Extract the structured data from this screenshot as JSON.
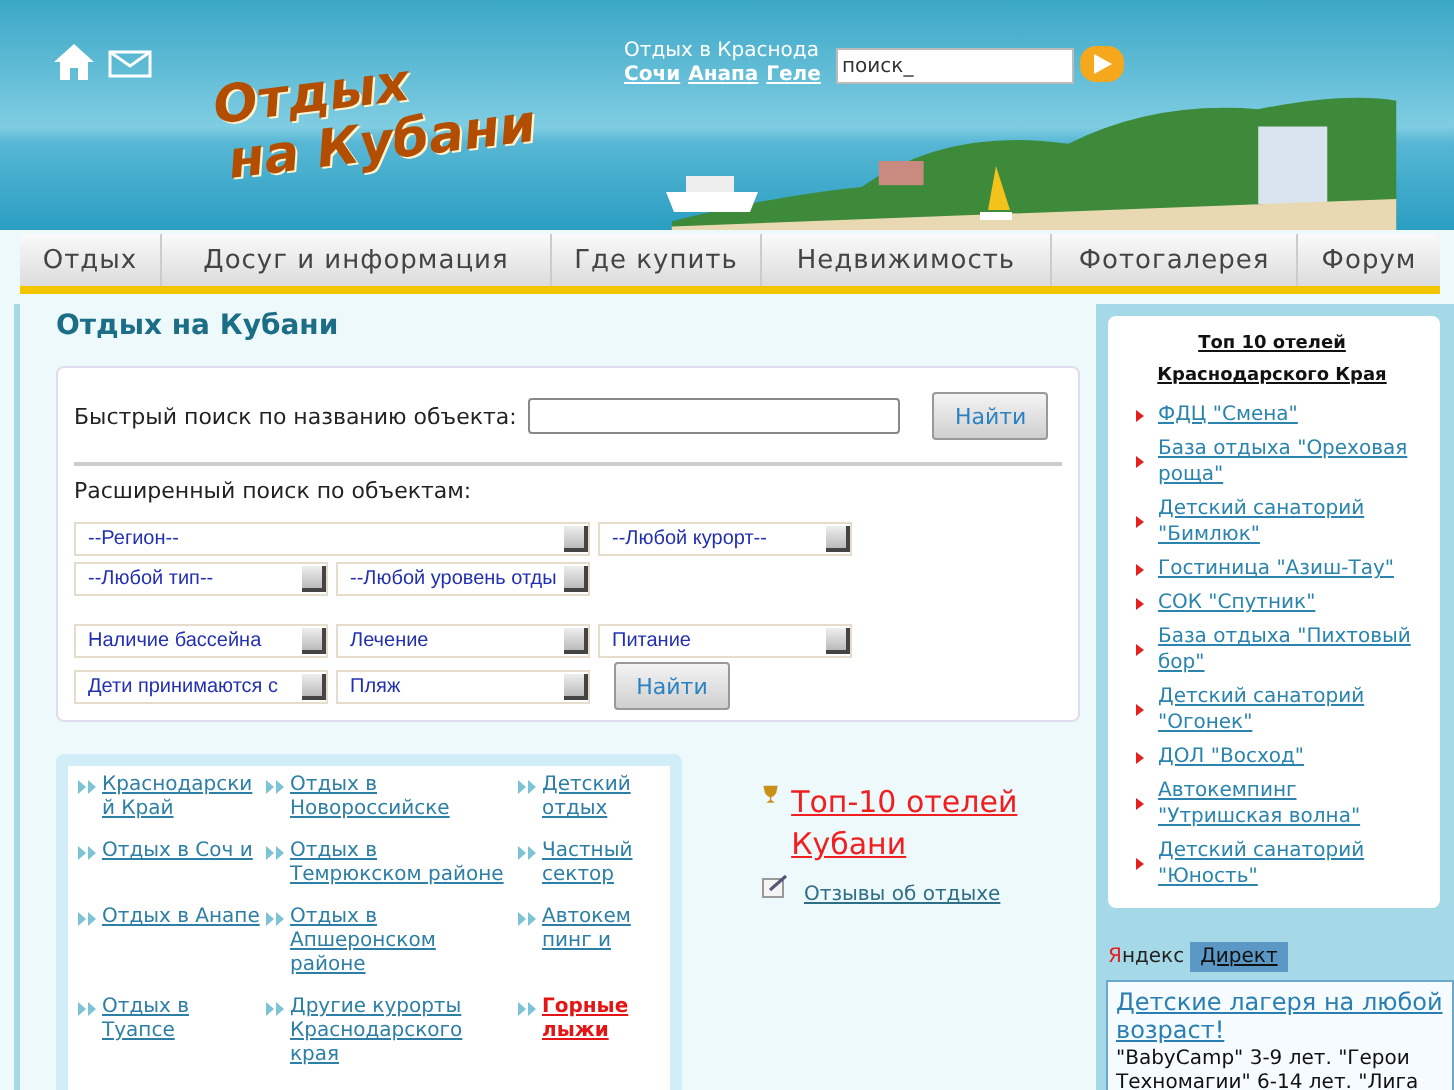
{
  "header": {
    "logo_line_1": "Отдых",
    "logo_line_2": "на Кубани",
    "tagline": "Отдых в Краснода",
    "city_links": [
      "Сочи",
      "Анапа",
      "Геле"
    ],
    "search": {
      "value": "поиск_"
    }
  },
  "nav": [
    {
      "label": "Отдых"
    },
    {
      "label": "Досуг и информация"
    },
    {
      "label": "Где купить"
    },
    {
      "label": "Недвижимость"
    },
    {
      "label": "Фотогалерея"
    },
    {
      "label": "Форум"
    }
  ],
  "page_title": "Отдых на Кубани",
  "quick_search": {
    "label": "Быстрый поиск по названию объекта:",
    "button": "Найти"
  },
  "advanced_search": {
    "label": "Расширенный поиск по объектам:",
    "dropdowns": [
      "--Регион--",
      "--Любой курорт--",
      "--Любой тип--",
      "--Любой уровень отды",
      "Наличие бассейна",
      "Лечение",
      "Питание",
      "Дети принимаются с",
      "Пляж"
    ],
    "button": "Найти"
  },
  "region_links": [
    {
      "label": "Краснодарский Край",
      "kind": "normal"
    },
    {
      "label": "Отдых в Новороссийске",
      "kind": "normal"
    },
    {
      "label": "Детский отдых",
      "kind": "normal"
    },
    {
      "label": "Отдых в Соч и",
      "kind": "normal"
    },
    {
      "label": "Отдых в Темрюкском районе",
      "kind": "normal"
    },
    {
      "label": "Частный сектор",
      "kind": "normal"
    },
    {
      "label": "Отдых в Анапе",
      "kind": "normal"
    },
    {
      "label": "Отдых в Апшеронском районе",
      "kind": "normal"
    },
    {
      "label": "Автокемпинг и",
      "kind": "normal"
    },
    {
      "label": "Отдых в Туапсе",
      "kind": "normal"
    },
    {
      "label": "Другие курорты Краснодарского края",
      "kind": "normal"
    },
    {
      "label": "Горные лыжи",
      "kind": "hot"
    }
  ],
  "top10_link": "Топ-10 отелей Кубани",
  "reviews_link": "Отзывы об отдыхе",
  "sidebar": {
    "title": "Топ 10 отелей Краснодарского Края",
    "items": [
      "ФДЦ \"Смена\"",
      "База отдыха \"Ореховая роща\"",
      "Детский санаторий \"Бимлюк\"",
      "Гостиница \"Азиш-Тау\"",
      "СОК \"Спутник\"",
      "База отдыха \"Пихтовый бор\"",
      "Детский санаторий \"Огонек\"",
      "ДОЛ \"Восход\"",
      "Автокемпинг \"Утришская волна\"",
      "Детский санаторий \"Юность\""
    ]
  },
  "ads": {
    "brand": "Яндекс",
    "tab": "Директ",
    "ad_title": "Детские лагеря на любой возраст!",
    "ad_text": "\"BabyCamp\" 3-9 лет. \"Герои Техномагии\" 6-14 лет. \"Лига"
  }
}
